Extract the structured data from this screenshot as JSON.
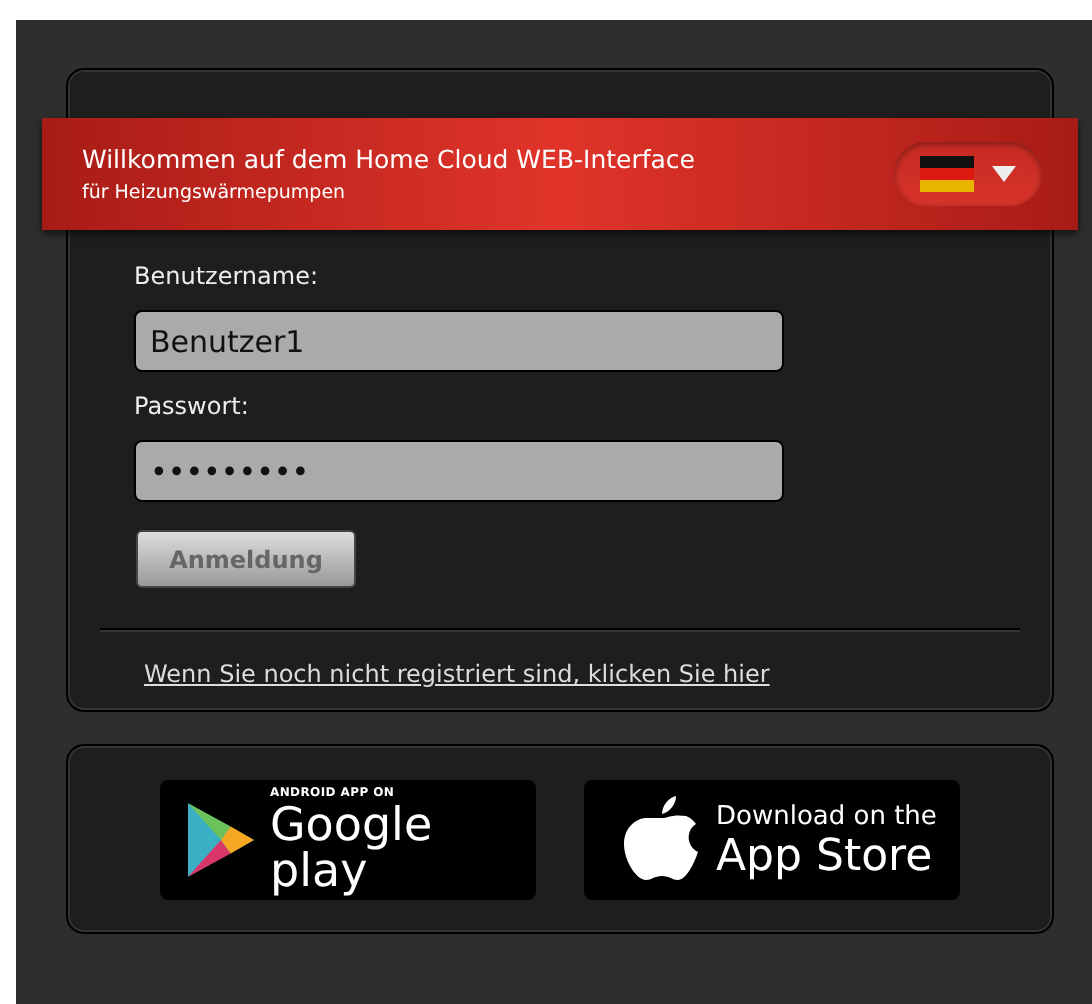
{
  "banner": {
    "title": "Willkommen auf dem Home Cloud WEB-Interface",
    "subtitle": "für Heizungswärmepumpen"
  },
  "login": {
    "fields": [
      {
        "label": "Benutzername:",
        "value": "Benutzer1"
      },
      {
        "label": "Passwort:",
        "value": "•••••••••"
      }
    ],
    "button": "Anmeldung",
    "register_link": "Wenn Sie noch nicht registriert sind, klicken Sie hier"
  },
  "stores": [
    {
      "kind": "google",
      "small_text": "ANDROID APP ON",
      "big_text": "Google play"
    },
    {
      "kind": "apple",
      "small_text": "Download on the",
      "big_text": "App Store"
    }
  ]
}
